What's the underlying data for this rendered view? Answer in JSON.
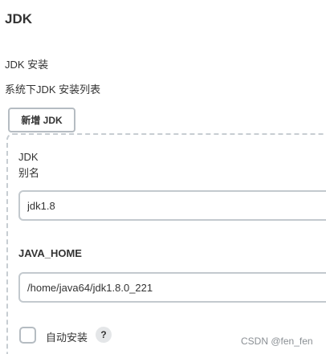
{
  "section": {
    "title": "JDK"
  },
  "installations": {
    "title": "JDK 安装",
    "description": "系统下JDK 安装列表",
    "add_button_label": "新增 JDK"
  },
  "jdk_entry": {
    "type_label": "JDK",
    "alias_label": "别名",
    "alias_value": "jdk1.8",
    "java_home_label": "JAVA_HOME",
    "java_home_value": "/home/java64/jdk1.8.0_221",
    "auto_install_label": "自动安装",
    "auto_install_checked": false,
    "help_icon_glyph": "?"
  },
  "watermark": "CSDN @fen_fen"
}
